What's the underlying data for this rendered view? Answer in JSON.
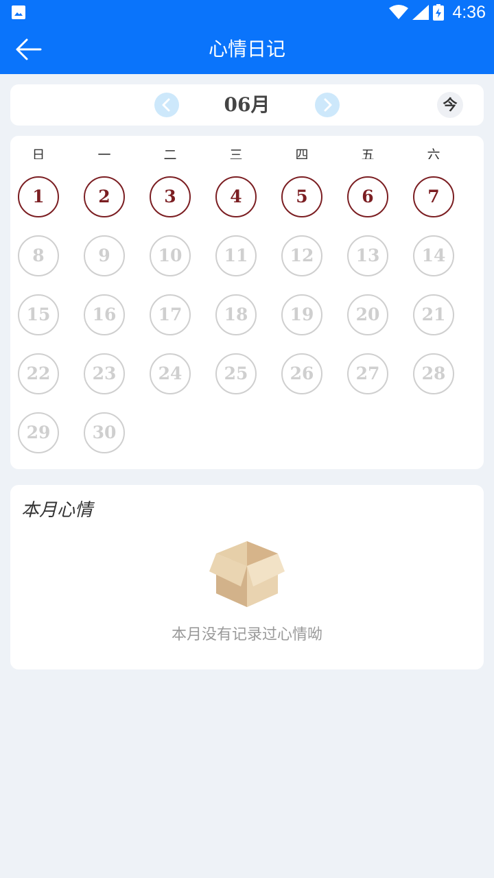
{
  "status_bar": {
    "time": "4:36"
  },
  "app_bar": {
    "title": "心情日记"
  },
  "month_nav": {
    "month": "06月",
    "today_label": "今"
  },
  "weekdays": [
    "日",
    "一",
    "二",
    "三",
    "四",
    "五",
    "六"
  ],
  "days": [
    "1",
    "2",
    "3",
    "4",
    "5",
    "6",
    "7",
    "8",
    "9",
    "10",
    "11",
    "12",
    "13",
    "14",
    "15",
    "16",
    "17",
    "18",
    "19",
    "20",
    "21",
    "22",
    "23",
    "24",
    "25",
    "26",
    "27",
    "28",
    "29",
    "30"
  ],
  "past_days_count": 7,
  "colors": {
    "primary": "#0a74fb",
    "past_day": "#7b1e22",
    "future_day": "#cfcfcf",
    "background": "#eef2f7"
  },
  "mood_section": {
    "title": "本月心情",
    "empty_text": "本月没有记录过心情呦"
  }
}
